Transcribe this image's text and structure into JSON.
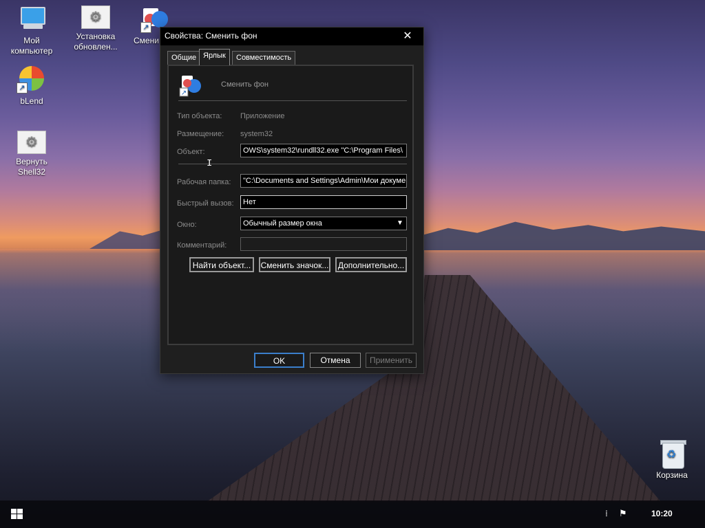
{
  "desktop": {
    "icons": [
      {
        "label": "Мой\nкомпьютер",
        "icon": "computer-icon"
      },
      {
        "label": "Установка\nобновлен...",
        "icon": "settings-icon"
      },
      {
        "label": "Смени",
        "icon": "theme-icon"
      },
      {
        "label": "bLend",
        "icon": "blend-icon"
      },
      {
        "label": "Вернуть\nShell32",
        "icon": "settings-icon"
      },
      {
        "label": "Корзина",
        "icon": "recycle-bin-icon"
      }
    ]
  },
  "dialog": {
    "title": "Свойства: Сменить фон",
    "close_glyph": "✕",
    "tabs": [
      {
        "label": "Общие",
        "active": false
      },
      {
        "label": "Ярлык",
        "active": true
      },
      {
        "label": "Совместимость",
        "active": false
      }
    ],
    "app_name": "Сменить фон",
    "fields": {
      "type_label": "Тип объекта:",
      "type_value": "Приложение",
      "location_label": "Размещение:",
      "location_value": "system32",
      "target_label": "Объект:",
      "target_value": "OWS\\system32\\rundll32.exe \"C:\\Program Files\\",
      "start_in_label": "Рабочая папка:",
      "start_in_value": "\"C:\\Documents and Settings\\Admin\\Мои докуме",
      "hotkey_label": "Быстрый вызов:",
      "hotkey_value": "Нет",
      "run_label": "Окно:",
      "run_value": "Обычный размер окна",
      "comment_label": "Комментарий:",
      "comment_value": ""
    },
    "buttons": {
      "find_target": "Найти объект...",
      "change_icon": "Сменить значок...",
      "advanced": "Дополнительно...",
      "ok": "OK",
      "cancel": "Отмена",
      "apply": "Применить"
    }
  },
  "taskbar": {
    "clock": "10:20"
  },
  "colors": {
    "dialog_bg": "#1f1f1f",
    "ok_border": "#3b7fcc",
    "taskbar_bg": "#0a0a0e"
  }
}
